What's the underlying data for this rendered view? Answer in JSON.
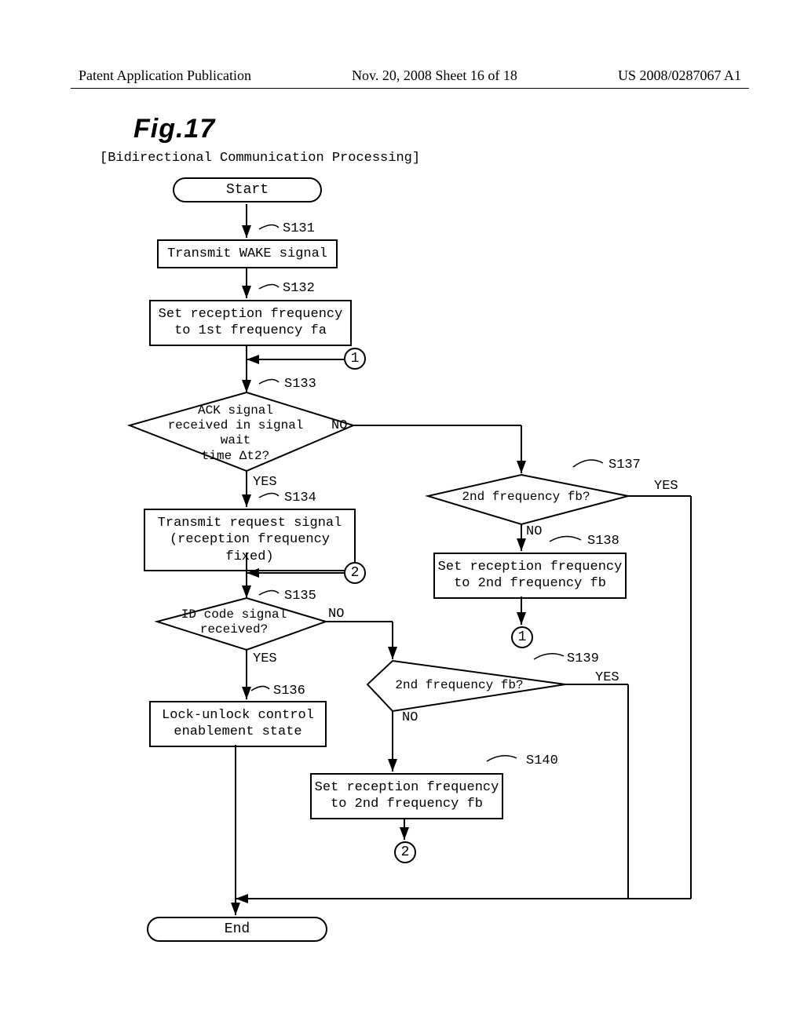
{
  "header": {
    "left": "Patent Application Publication",
    "center": "Nov. 20, 2008  Sheet 16 of 18",
    "right": "US 2008/0287067 A1"
  },
  "figure_title": "Fig.17",
  "subtitle": "[Bidirectional Communication Processing]",
  "terminals": {
    "start": "Start",
    "end": "End"
  },
  "steps": {
    "s131_label": "S131",
    "s131": "Transmit WAKE signal",
    "s132_label": "S132",
    "s132_line1": "Set reception frequency",
    "s132_line2": "to 1st frequency fa",
    "s133_label": "S133",
    "s133_line1": "ACK signal",
    "s133_line2": "received in signal wait",
    "s133_line3": "time Δt2?",
    "s134_label": "S134",
    "s134_line1": "Transmit request signal",
    "s134_line2": "(reception frequency fixed)",
    "s135_label": "S135",
    "s135_line1": "ID code signal",
    "s135_line2": "received?",
    "s136_label": "S136",
    "s136_line1": "Lock-unlock control",
    "s136_line2": "enablement state",
    "s137_label": "S137",
    "s137": "2nd frequency fb?",
    "s138_label": "S138",
    "s138_line1": "Set reception frequency",
    "s138_line2": "to 2nd frequency fb",
    "s139_label": "S139",
    "s139": "2nd frequency fb?",
    "s140_label": "S140",
    "s140_line1": "Set reception frequency",
    "s140_line2": "to 2nd frequency fb"
  },
  "labels": {
    "yes": "YES",
    "no": "NO"
  },
  "connectors": {
    "one": "1",
    "two": "2"
  }
}
